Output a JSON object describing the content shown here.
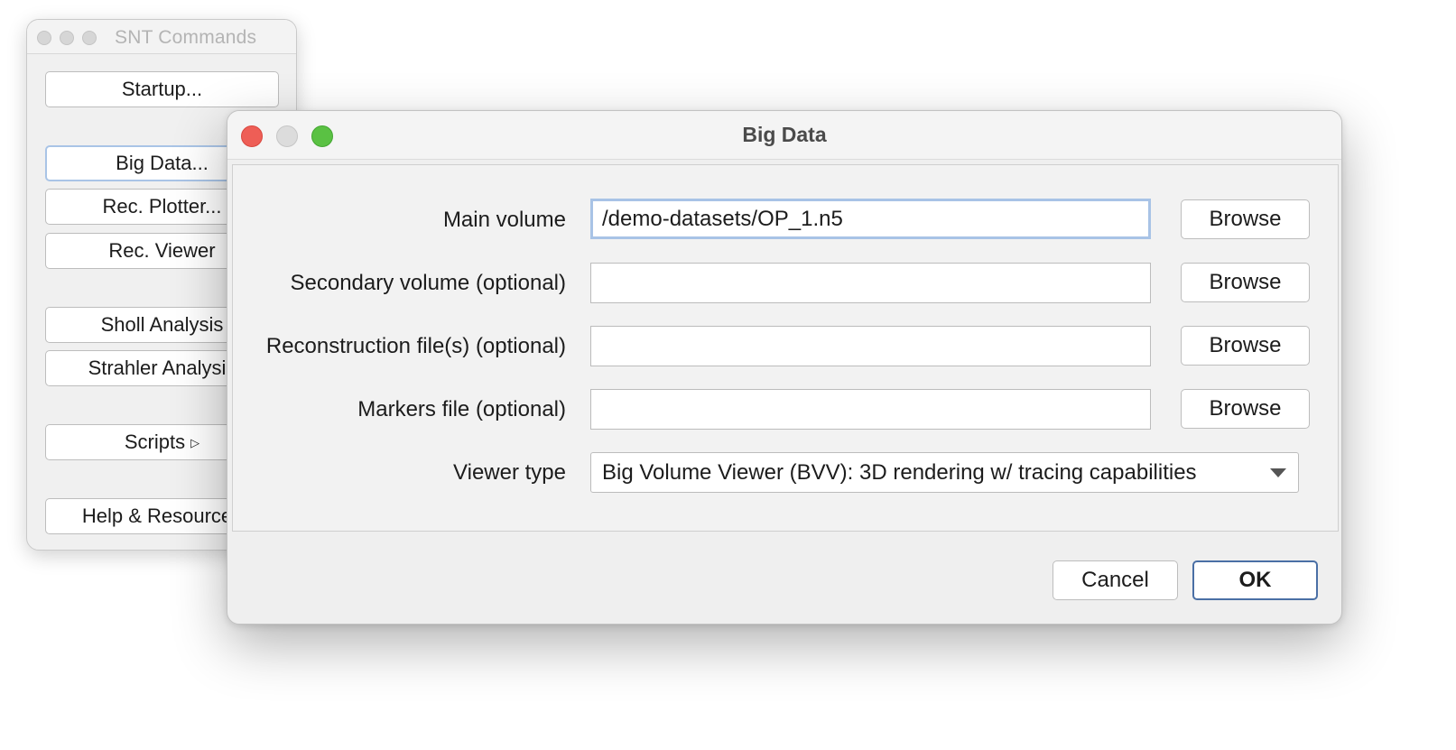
{
  "snt_window": {
    "title": "SNT Commands",
    "buttons": [
      {
        "label": "Startup..."
      },
      {
        "label": "Big Data..."
      },
      {
        "label": "Rec. Plotter..."
      },
      {
        "label": "Rec. Viewer"
      },
      {
        "label": "Sholl Analysis"
      },
      {
        "label": "Strahler Analysis"
      },
      {
        "label": "Scripts"
      },
      {
        "label": "Help & Resources"
      }
    ]
  },
  "dialog": {
    "title": "Big Data",
    "fields": [
      {
        "label": "Main volume",
        "value": "/demo-datasets/OP_1.n5",
        "browse_label": "Browse"
      },
      {
        "label": "Secondary volume (optional)",
        "value": "",
        "browse_label": "Browse"
      },
      {
        "label": "Reconstruction file(s) (optional)",
        "value": "",
        "browse_label": "Browse"
      },
      {
        "label": "Markers file (optional)",
        "value": "",
        "browse_label": "Browse"
      }
    ],
    "viewer_type": {
      "label": "Viewer type",
      "selected": "Big Volume Viewer (BVV): 3D rendering w/ tracing capabilities"
    },
    "cancel_label": "Cancel",
    "ok_label": "OK"
  },
  "colors": {
    "close": "#ee5e56",
    "zoom": "#5ac143",
    "focus_ring": "#a8c3e6",
    "default_button_border": "#4a6fa5"
  }
}
